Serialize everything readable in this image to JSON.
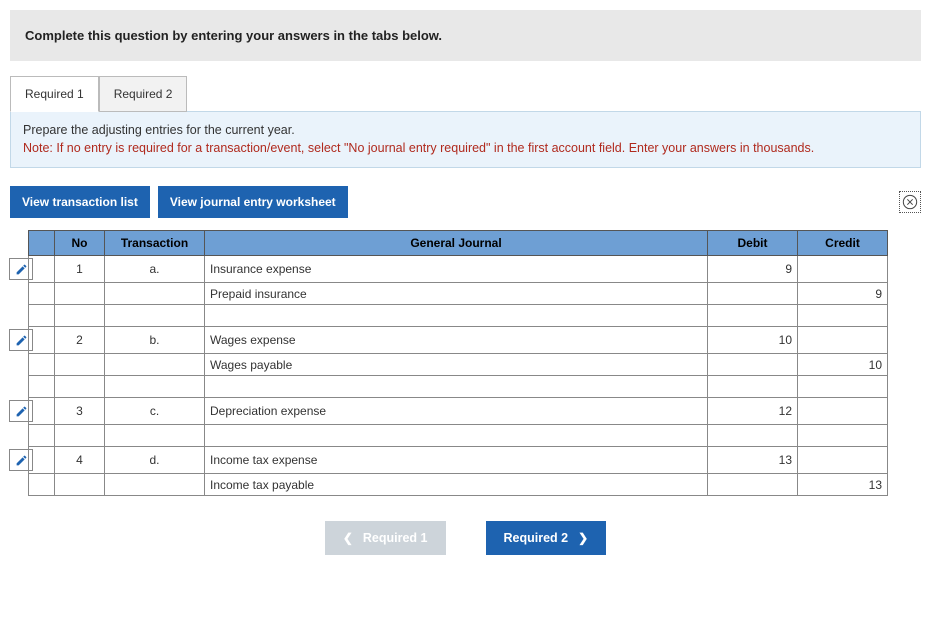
{
  "instruction": "Complete this question by entering your answers in the tabs below.",
  "tabs": {
    "t1": "Required 1",
    "t2": "Required 2"
  },
  "prompt": {
    "main": "Prepare the adjusting entries for the current year.",
    "note": "Note: If no entry is required for a transaction/event, select \"No journal entry required\" in the first account field. Enter your answers in thousands."
  },
  "actions": {
    "view_trx": "View transaction list",
    "view_ws": "View journal entry worksheet"
  },
  "headers": {
    "no": "No",
    "trx": "Transaction",
    "gj": "General Journal",
    "debit": "Debit",
    "credit": "Credit"
  },
  "rows": {
    "r1_no": "1",
    "r1_trx": "a.",
    "r1_acc": "Insurance expense",
    "r1_d": "9",
    "r1_c": "",
    "r1b_acc": "Prepaid insurance",
    "r1b_d": "",
    "r1b_c": "9",
    "r2_no": "2",
    "r2_trx": "b.",
    "r2_acc": "Wages expense",
    "r2_d": "10",
    "r2_c": "",
    "r2b_acc": "Wages payable",
    "r2b_d": "",
    "r2b_c": "10",
    "r3_no": "3",
    "r3_trx": "c.",
    "r3_acc": "Depreciation expense",
    "r3_d": "12",
    "r3_c": "",
    "r4_no": "4",
    "r4_trx": "d.",
    "r4_acc": "Income tax expense",
    "r4_d": "13",
    "r4_c": "",
    "r4b_acc": "Income tax payable",
    "r4b_d": "",
    "r4b_c": "13"
  },
  "nav": {
    "prev": "Required 1",
    "next": "Required 2"
  }
}
